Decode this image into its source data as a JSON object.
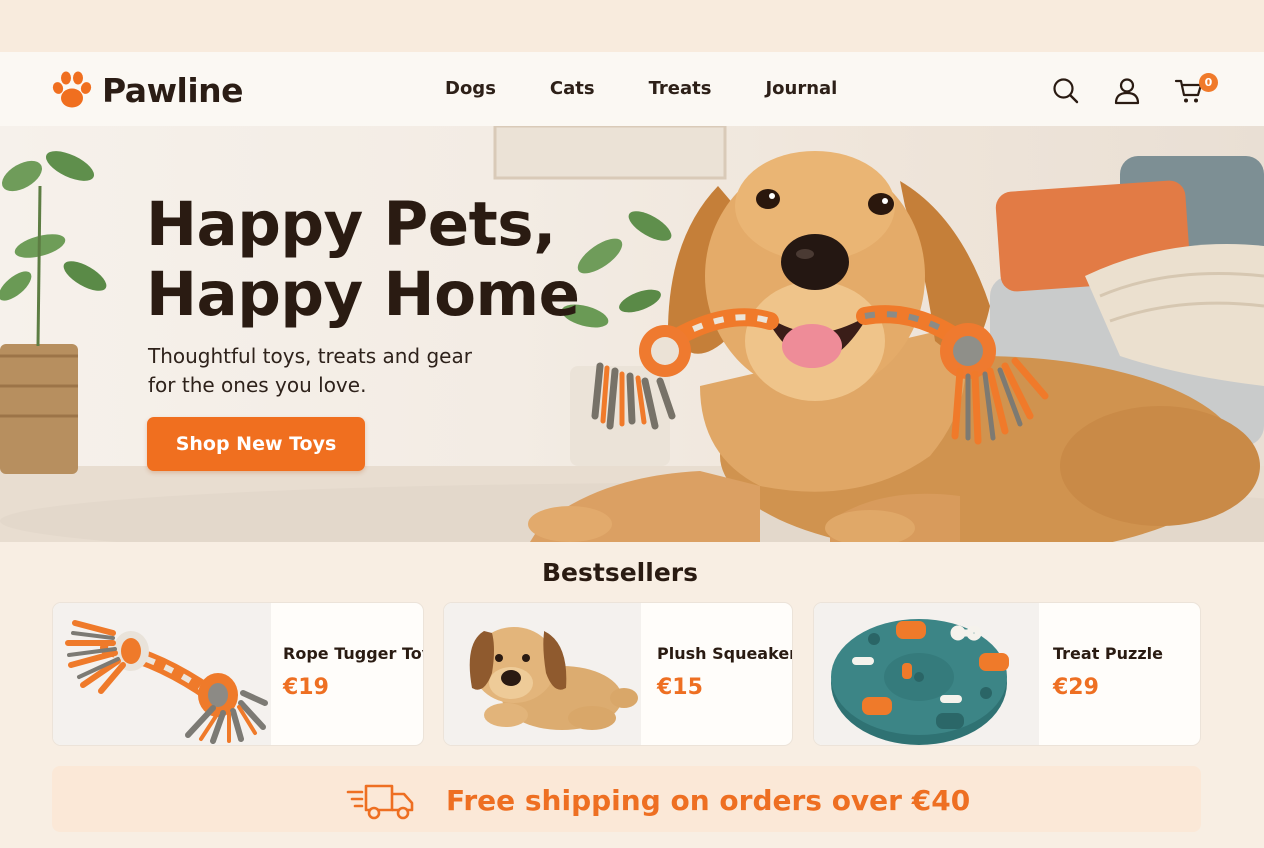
{
  "brand": {
    "name": "Pawline",
    "logo_icon": "paw-icon"
  },
  "nav": {
    "items": [
      {
        "label": "Dogs"
      },
      {
        "label": "Cats"
      },
      {
        "label": "Treats"
      },
      {
        "label": "Journal"
      }
    ]
  },
  "header_actions": {
    "search_icon": "search-icon",
    "account_icon": "user-icon",
    "cart_icon": "cart-icon",
    "cart_count": "0"
  },
  "hero": {
    "title_line1": "Happy Pets,",
    "title_line2": "Happy Home",
    "subtitle_line1": "Thoughtful toys, treats and gear",
    "subtitle_line2": "for the ones you love.",
    "cta_label": "Shop New Toys"
  },
  "bestsellers": {
    "title": "Bestsellers",
    "products": [
      {
        "name": "Rope Tugger Toy",
        "price": "€19"
      },
      {
        "name": "Plush Squeaker",
        "price": "€15"
      },
      {
        "name": "Treat Puzzle",
        "price": "€29"
      }
    ]
  },
  "shipping": {
    "icon": "delivery-truck-icon",
    "text": "Free shipping on orders over €40"
  },
  "colors": {
    "accent": "#f06f1f",
    "background": "#f8eee3",
    "header_bg": "#fbf8f3",
    "text_dark": "#2a1b12",
    "shipping_bg": "#fbe8d7"
  }
}
